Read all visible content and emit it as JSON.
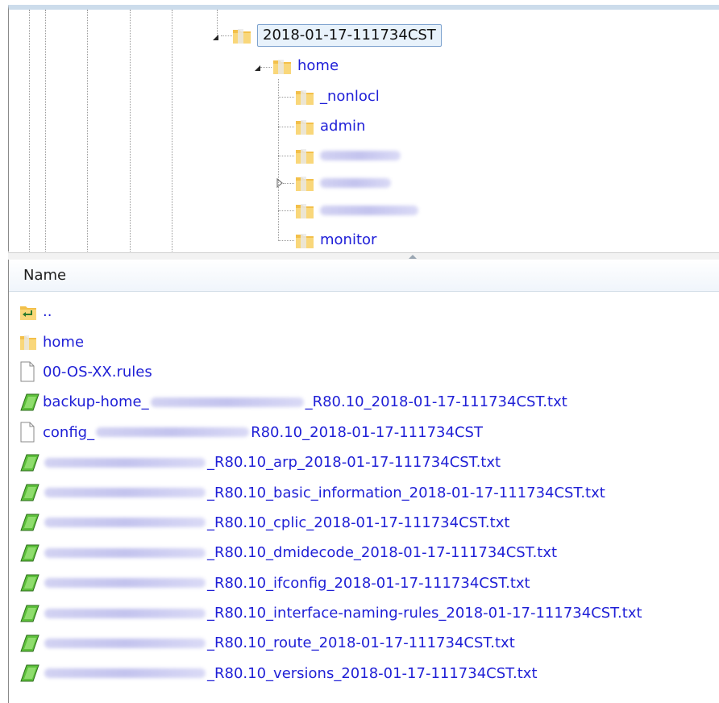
{
  "tree": {
    "root": {
      "label": "2018-01-17-111734CST"
    },
    "home": {
      "label": "home"
    },
    "children": [
      {
        "label": "_nonlocl",
        "redacted": false,
        "expandable": false
      },
      {
        "label": "admin",
        "redacted": false,
        "expandable": false
      },
      {
        "label": "",
        "redacted": true,
        "expandable": false
      },
      {
        "label": "",
        "redacted": true,
        "expandable": true
      },
      {
        "label": "",
        "redacted": true,
        "expandable": false
      },
      {
        "label": "monitor",
        "redacted": false,
        "expandable": false
      }
    ]
  },
  "list": {
    "column_name": "Name",
    "items": [
      {
        "type": "parent",
        "prefix": "..",
        "suffix": ""
      },
      {
        "type": "folder",
        "prefix": "home",
        "suffix": ""
      },
      {
        "type": "file",
        "prefix": "00-OS-XX.rules",
        "suffix": ""
      },
      {
        "type": "textfile",
        "prefix": "backup-home_",
        "redacted": true,
        "suffix": "_R80.10_2018-01-17-111734CST.txt"
      },
      {
        "type": "file",
        "prefix": "config_",
        "redacted": true,
        "suffix": "R80.10_2018-01-17-111734CST"
      },
      {
        "type": "textfile",
        "prefix": "",
        "redacted": true,
        "suffix": "_R80.10_arp_2018-01-17-111734CST.txt"
      },
      {
        "type": "textfile",
        "prefix": "",
        "redacted": true,
        "suffix": "_R80.10_basic_information_2018-01-17-111734CST.txt"
      },
      {
        "type": "textfile",
        "prefix": "",
        "redacted": true,
        "suffix": "_R80.10_cplic_2018-01-17-111734CST.txt"
      },
      {
        "type": "textfile",
        "prefix": "",
        "redacted": true,
        "suffix": "_R80.10_dmidecode_2018-01-17-111734CST.txt"
      },
      {
        "type": "textfile",
        "prefix": "",
        "redacted": true,
        "suffix": "_R80.10_ifconfig_2018-01-17-111734CST.txt"
      },
      {
        "type": "textfile",
        "prefix": "",
        "redacted": true,
        "suffix": "_R80.10_interface-naming-rules_2018-01-17-111734CST.txt"
      },
      {
        "type": "textfile",
        "prefix": "",
        "redacted": true,
        "suffix": "_R80.10_route_2018-01-17-111734CST.txt"
      },
      {
        "type": "textfile",
        "prefix": "",
        "redacted": true,
        "suffix": "_R80.10_versions_2018-01-17-111734CST.txt"
      }
    ]
  },
  "colors": {
    "link": "#1f1fd6",
    "folder": "#f3c04a",
    "textfile": "#5cbf3a",
    "selection_border": "#7da2ce"
  }
}
